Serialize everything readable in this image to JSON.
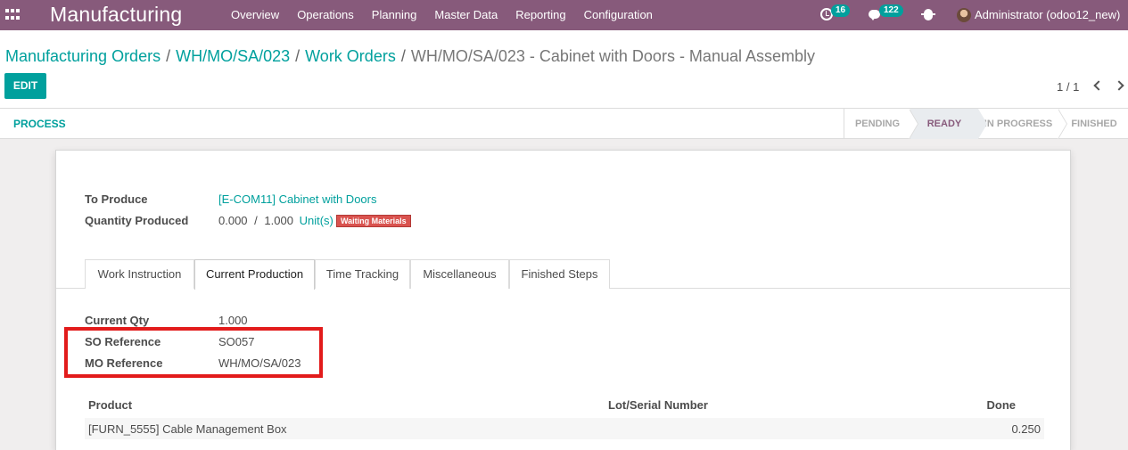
{
  "navbar": {
    "app_name": "Manufacturing",
    "menu": [
      "Overview",
      "Operations",
      "Planning",
      "Master Data",
      "Reporting",
      "Configuration"
    ],
    "activity_count": "16",
    "message_count": "122",
    "user": "Administrator (odoo12_new)"
  },
  "breadcrumb": {
    "items": [
      "Manufacturing Orders",
      "WH/MO/SA/023",
      "Work Orders"
    ],
    "separator": "/",
    "current": "WH/MO/SA/023 - Cabinet with Doors - Manual Assembly"
  },
  "toolbar": {
    "edit_label": "EDIT",
    "pager": "1 / 1"
  },
  "statusbar": {
    "process_label": "PROCESS",
    "stages": [
      "PENDING",
      "READY",
      "IN PROGRESS",
      "FINISHED"
    ],
    "current_stage": "READY"
  },
  "form": {
    "to_produce_label": "To Produce",
    "to_produce_value": "[E-COM11] Cabinet with Doors",
    "qty_produced_label": "Quantity Produced",
    "qty_produced_value": "0.000",
    "qty_sep": "/",
    "qty_total": "1.000",
    "qty_uom": "Unit(s)",
    "state_badge": "Waiting Materials",
    "tabs": [
      "Work Instruction",
      "Current Production",
      "Time Tracking",
      "Miscellaneous",
      "Finished Steps"
    ],
    "active_tab": "Current Production",
    "current_qty_label": "Current Qty",
    "current_qty_value": "1.000",
    "so_ref_label": "SO Reference",
    "so_ref_value": "SO057",
    "mo_ref_label": "MO Reference",
    "mo_ref_value": "WH/MO/SA/023",
    "table": {
      "headers": [
        "Product",
        "Lot/Serial Number",
        "Done"
      ],
      "rows": [
        {
          "product": "[FURN_5555] Cable Management Box",
          "lot": "",
          "done": "0.250"
        }
      ]
    }
  },
  "colors": {
    "navbar": "#875a7b",
    "accent": "#00a09d",
    "badge_danger": "#d9534f",
    "highlight": "#e21b1b"
  }
}
